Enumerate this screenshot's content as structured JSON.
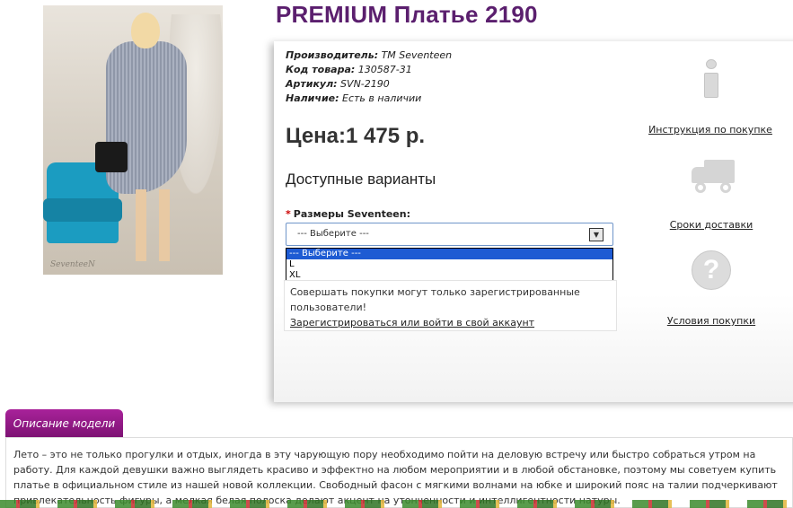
{
  "product": {
    "title": "PREMIUM Платье 2190",
    "photo_watermark": "SeventeeN"
  },
  "meta": {
    "manufacturer_label": "Производитель:",
    "manufacturer_value": " TM Seventeen",
    "code_label": "Код товара:",
    "code_value": " 130587-31",
    "article_label": "Артикул:",
    "article_value": " SVN-2190",
    "availability_label": "Наличие:",
    "availability_value": " Есть в наличии"
  },
  "price": {
    "text": "Цена:1 475 р."
  },
  "variants": {
    "heading": "Доступные варианты",
    "size_label": "Размеры Seventeen:",
    "required_mark": "*",
    "selected": "--- Выберите ---",
    "options": [
      "--- Выберите ---",
      "L",
      "XL"
    ]
  },
  "login": {
    "message": "Совершать покупки могут только зарегистрированные пользователи!",
    "link": "Зарегистрироваться или войти в свой аккаунт"
  },
  "side": {
    "instruction": "Инструкция по покупке",
    "delivery": "Сроки доставки",
    "conditions": "Условия покупки"
  },
  "description": {
    "tab_label": "Описание модели",
    "text": "Лето – это не только прогулки и отдых, иногда в эту чарующую пору необходимо пойти на деловую встречу или быстро собраться утром на работу. Для каждой девушки важно выглядеть красиво и эффектно на любом мероприятии и в любой обстановке, поэтому мы советуем купить платье в официальном стиле из нашей новой коллекции. Свободный фасон с мягкими волнами на юбке и широкий пояс на талии подчеркивают привлекательность фигуры, а мелкая белая полоска делают акцент на утонченности и интеллигентности натуры."
  }
}
